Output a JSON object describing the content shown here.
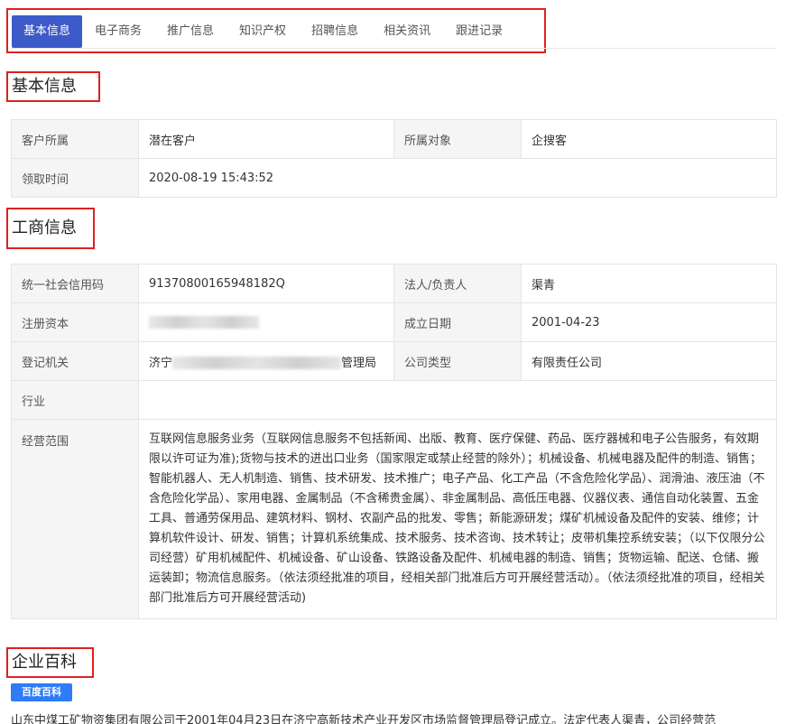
{
  "tabs": [
    {
      "label": "基本信息",
      "active": true
    },
    {
      "label": "电子商务",
      "active": false
    },
    {
      "label": "推广信息",
      "active": false
    },
    {
      "label": "知识产权",
      "active": false
    },
    {
      "label": "招聘信息",
      "active": false
    },
    {
      "label": "相关资讯",
      "active": false
    },
    {
      "label": "跟进记录",
      "active": false
    }
  ],
  "basic": {
    "title": "基本信息",
    "customer_owner_label": "客户所属",
    "customer_owner_value": "潜在客户",
    "owner_object_label": "所属对象",
    "owner_object_value": "企搜客",
    "claim_time_label": "领取时间",
    "claim_time_value": "2020-08-19 15:43:52"
  },
  "business": {
    "title": "工商信息",
    "credit_code_label": "统一社会信用码",
    "credit_code_value": "91370800165948182Q",
    "legal_person_label": "法人/负责人",
    "legal_person_value": "渠青",
    "reg_capital_label": "注册资本",
    "established_label": "成立日期",
    "established_value": "2001-04-23",
    "reg_authority_label": "登记机关",
    "reg_authority_prefix": "济宁",
    "reg_authority_suffix": "管理局",
    "company_type_label": "公司类型",
    "company_type_value": "有限责任公司",
    "industry_label": "行业",
    "industry_value": "",
    "scope_label": "经营范围",
    "scope_value": "互联网信息服务业务（互联网信息服务不包括新闻、出版、教育、医疗保健、药品、医疗器械和电子公告服务，有效期限以许可证为准);货物与技术的进出口业务（国家限定或禁止经营的除外）；机械设备、机械电器及配件的制造、销售；智能机器人、无人机制造、销售、技术研发、技术推广；电子产品、化工产品（不含危险化学品）、润滑油、液压油（不含危险化学品）、家用电器、金属制品（不含稀贵金属）、非金属制品、高低压电器、仪器仪表、通信自动化装置、五金工具、普通劳保用品、建筑材料、钢材、农副产品的批发、零售；新能源研发；煤矿机械设备及配件的安装、维修；计算机软件设计、研发、销售；计算机系统集成、技术服务、技术咨询、技术转让；皮带机集控系统安装；（以下仅限分公司经营）矿用机械配件、机械设备、矿山设备、铁路设备及配件、机械电器的制造、销售；货物运输、配送、仓储、搬运装卸；物流信息服务。（依法须经批准的项目，经相关部门批准后方可开展经营活动）。（依法须经批准的项目，经相关部门批准后方可开展经营活动)"
  },
  "encyclopedia": {
    "title": "企业百科",
    "badge": "百度百科",
    "text": "山东中煤工矿物资集团有限公司于2001年04月23日在济宁高新技术产业开发区市场监督管理局登记成立。法定代表人渠青，公司经营范"
  },
  "colors": {
    "accent": "#3c5ac8",
    "highlight_border": "#e02020",
    "baidu_blue": "#2e7cf6"
  }
}
